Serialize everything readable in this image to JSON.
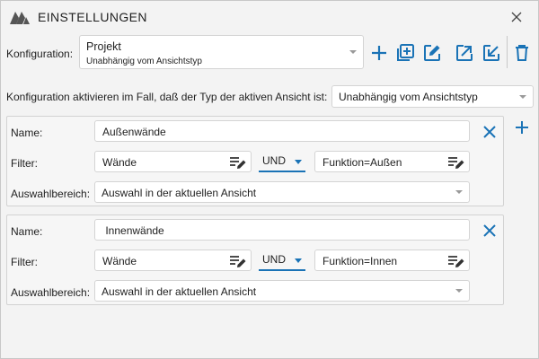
{
  "window": {
    "title": "EINSTELLUNGEN",
    "close_icon": "close-icon",
    "logo_icon": "app-logo"
  },
  "config": {
    "label": "Konfiguration:",
    "selected_title": "Projekt",
    "selected_sub": "Unabhängig vom Ansichtstyp",
    "toolbar": [
      "add-icon",
      "add-copy-icon",
      "edit-icon",
      "export-icon",
      "import-icon",
      "delete-icon"
    ]
  },
  "activation": {
    "label": "Konfiguration aktivieren im Fall, daß der Typ der aktiven Ansicht ist:",
    "value": "Unabhängig vom Ansichtstyp"
  },
  "labels": {
    "name": "Name:",
    "filter": "Filter:",
    "scope": "Auswahlbereich:"
  },
  "rules": [
    {
      "name": "Außenwände",
      "filter1": "Wände",
      "operator": "UND",
      "filter2": "Funktion=Außen",
      "scope": "Auswahl in der aktuellen Ansicht"
    },
    {
      "name": " Innenwände",
      "filter1": "Wände",
      "operator": "UND",
      "filter2": "Funktion=Innen",
      "scope": "Auswahl in der aktuellen Ansicht"
    }
  ],
  "colors": {
    "accent": "#1a73b6",
    "background": "#f3f3f3"
  }
}
